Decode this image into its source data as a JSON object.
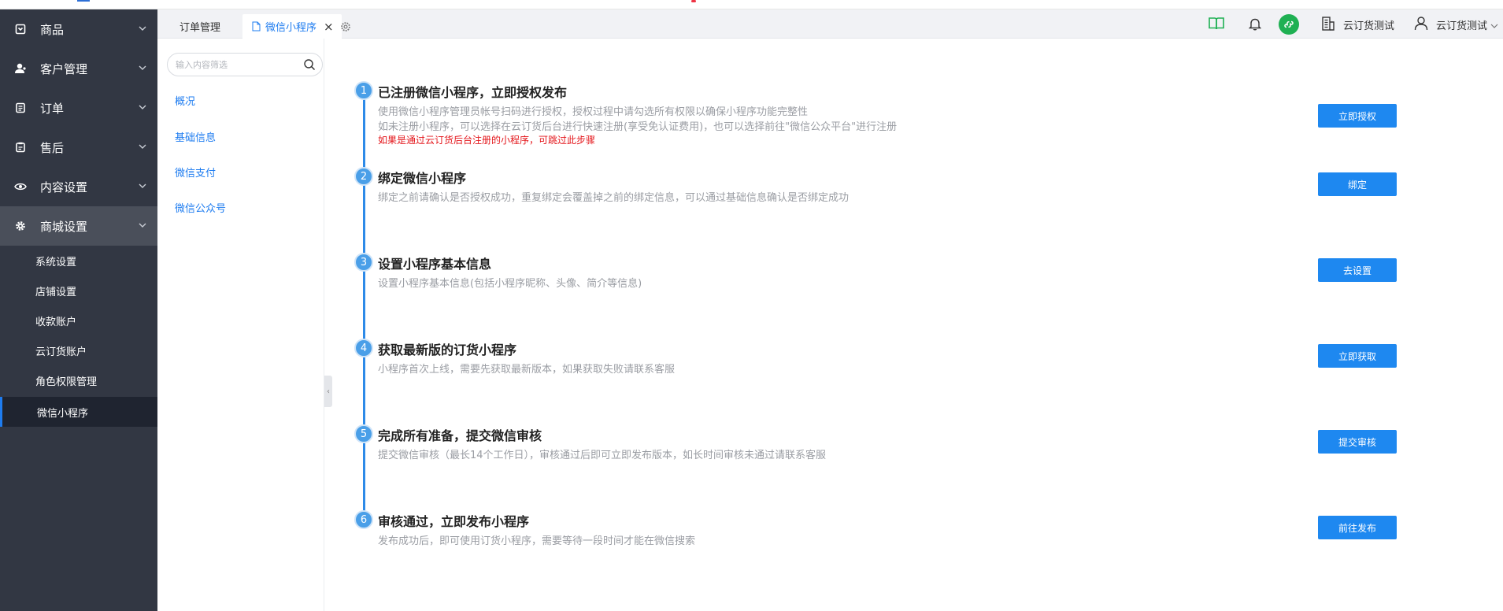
{
  "sidebar": {
    "items": [
      {
        "label": "商品",
        "icon": "product-icon"
      },
      {
        "label": "客户管理",
        "icon": "user-icon"
      },
      {
        "label": "订单",
        "icon": "order-icon"
      },
      {
        "label": "售后",
        "icon": "after-sales-icon"
      },
      {
        "label": "内容设置",
        "icon": "eye-icon"
      },
      {
        "label": "商城设置",
        "icon": "gear-icon"
      }
    ],
    "sub_items": [
      "系统设置",
      "店铺设置",
      "收款账户",
      "云订货账户",
      "角色权限管理",
      "微信小程序"
    ]
  },
  "tabs": {
    "items": [
      "订单管理",
      "微信小程序"
    ],
    "close_glyph": "×"
  },
  "header": {
    "org_name": "云订货测试",
    "user_name": "云订货测试"
  },
  "subpanel": {
    "search_placeholder": "输入内容筛选",
    "items": [
      "概况",
      "基础信息",
      "微信支付",
      "微信公众号"
    ]
  },
  "steps": [
    {
      "num": "1",
      "title": "已注册微信小程序，立即授权发布",
      "desc": [
        "使用微信小程序管理员帐号扫码进行授权，授权过程中请勾选所有权限以确保小程序功能完整性",
        "如未注册小程序，可以选择在云订货后台进行快速注册(享受免认证费用)，也可以选择前往\"微信公众平台\"进行注册"
      ],
      "note": "如果是通过云订货后台注册的小程序，可跳过此步骤",
      "button": "立即授权"
    },
    {
      "num": "2",
      "title": "绑定微信小程序",
      "desc": [
        "绑定之前请确认是否授权成功，重复绑定会覆盖掉之前的绑定信息，可以通过基础信息确认是否绑定成功"
      ],
      "button": "绑定"
    },
    {
      "num": "3",
      "title": "设置小程序基本信息",
      "desc": [
        "设置小程序基本信息(包括小程序昵称、头像、简介等信息)"
      ],
      "button": "去设置"
    },
    {
      "num": "4",
      "title": "获取最新版的订货小程序",
      "desc": [
        "小程序首次上线，需要先获取最新版本，如果获取失败请联系客服"
      ],
      "button": "立即获取"
    },
    {
      "num": "5",
      "title": "完成所有准备，提交微信审核",
      "desc": [
        "提交微信审核（最长14个工作日），审核通过后即可立即发布版本，如长时间审核未通过请联系客服"
      ],
      "button": "提交审核"
    },
    {
      "num": "6",
      "title": "审核通过，立即发布小程序",
      "desc": [
        "发布成功后，即可使用订货小程序，需要等待一段时间才能在微信搜索"
      ],
      "button": "前往发布"
    }
  ],
  "colors": {
    "sidebar_bg": "#323743",
    "accent": "#1e88f0",
    "note_red": "#e4161b",
    "mini_program_green": "#1fb053"
  }
}
